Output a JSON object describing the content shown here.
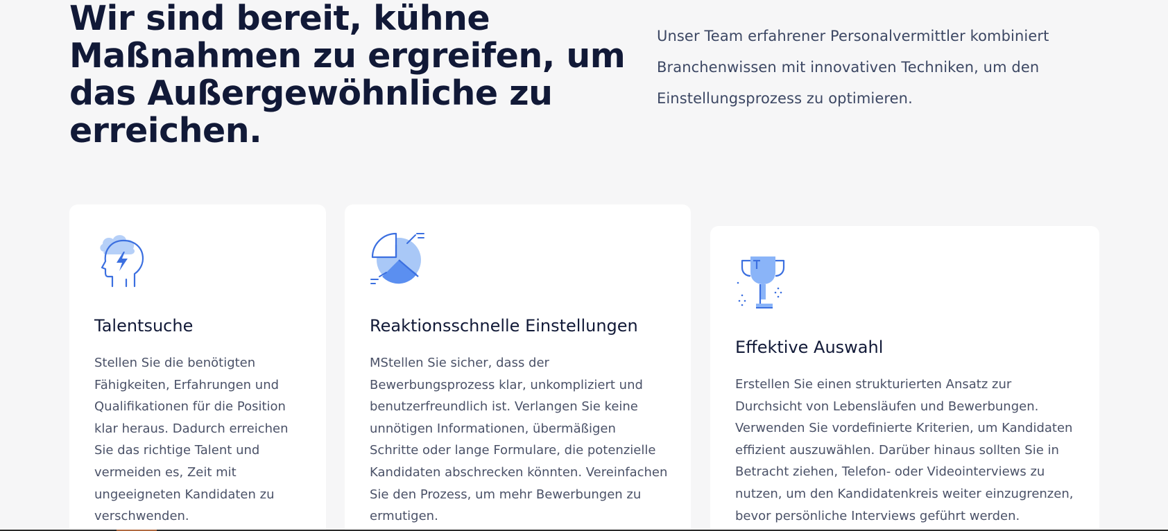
{
  "hero": {
    "title": "Wir sind bereit, kühne Maßnahmen zu ergreifen, um das Außergewöhnliche zu erreichen.",
    "description": "Unser Team erfahrener Personalvermittler kombiniert Branchenwissen mit innovativen Techniken, um den Einstellungsprozess zu optimieren."
  },
  "cards": [
    {
      "icon": "head-lightning-icon",
      "title": "Talentsuche",
      "text": "Stellen Sie die benötigten Fähigkeiten, Erfahrungen und Qualifikationen für die Position klar heraus. Dadurch erreichen Sie das richtige Talent und vermeiden es, Zeit mit ungeeigneten Kandidaten zu verschwenden."
    },
    {
      "icon": "pie-chart-icon",
      "title": "Reaktionsschnelle Einstellungen",
      "text": "MStellen Sie sicher, dass der Bewerbungsprozess klar, unkompliziert und benutzerfreundlich ist. Verlangen Sie keine unnötigen Informationen, übermäßigen Schritte oder lange Formulare, die potenzielle Kandidaten abschrecken könnten. Vereinfachen Sie den Prozess, um mehr Bewerbungen zu ermutigen."
    },
    {
      "icon": "trophy-icon",
      "title": "Effektive Auswahl",
      "text": "Erstellen Sie einen strukturierten Ansatz zur Durchsicht von Lebensläufen und Bewerbungen. Verwenden Sie vordefinierte Kriterien, um Kandidaten effizient auszuwählen. Darüber hinaus sollten Sie in Betracht ziehen, Telefon- oder Videointerviews zu nutzen, um den Kandidatenkreis weiter einzugrenzen, bevor persönliche Interviews geführt werden."
    }
  ],
  "colors": {
    "background": "#f6f6f7",
    "heading": "#111937",
    "body": "#4a5167",
    "icon_stroke": "#3b6fe0",
    "icon_fill": "#8ab4f8"
  }
}
